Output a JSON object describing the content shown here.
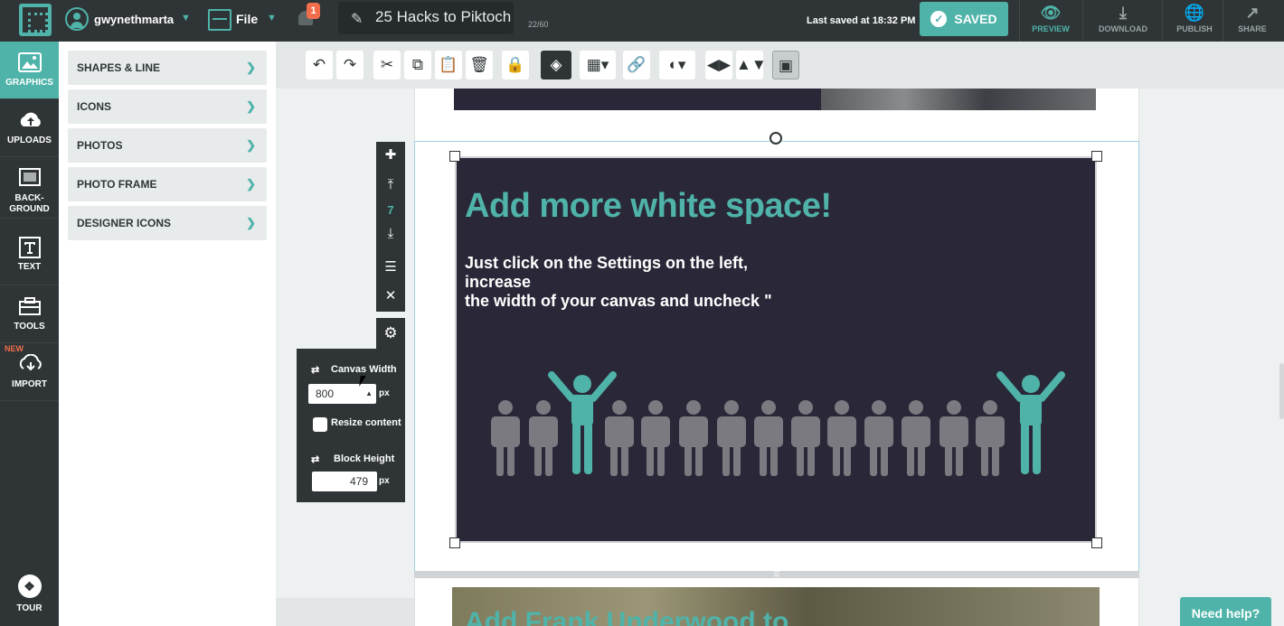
{
  "topbar": {
    "username": "gwynethmarta",
    "file_label": "File",
    "notification_count": "1",
    "doc_title": "25 Hacks to Piktoch",
    "char_count": "22/60",
    "last_saved": "Last saved at 18:32 PM",
    "saved_label": "SAVED",
    "actions": [
      {
        "label": "PREVIEW",
        "icon": "eye-icon"
      },
      {
        "label": "DOWNLOAD",
        "icon": "download-icon"
      },
      {
        "label": "PUBLISH",
        "icon": "globe-icon"
      },
      {
        "label": "SHARE",
        "icon": "share-icon"
      }
    ]
  },
  "sidebar": {
    "items": [
      {
        "label": "GRAPHICS",
        "icon": "image-icon"
      },
      {
        "label": "UPLOADS",
        "icon": "upload-cloud-icon"
      },
      {
        "label": "BACK-",
        "label2": "GROUND",
        "icon": "background-icon"
      },
      {
        "label": "TEXT",
        "icon": "text-icon"
      },
      {
        "label": "TOOLS",
        "icon": "tools-icon"
      },
      {
        "label": "IMPORT",
        "icon": "import-cloud-icon",
        "tag": "NEW"
      }
    ],
    "tour_label": "TOUR"
  },
  "panel": {
    "items": [
      {
        "label": "SHAPES & LINE"
      },
      {
        "label": "ICONS"
      },
      {
        "label": "PHOTOS"
      },
      {
        "label": "PHOTO FRAME"
      },
      {
        "label": "DESIGNER ICONS"
      }
    ]
  },
  "toolbar": {
    "tools": [
      "undo-icon",
      "redo-icon",
      "cut-icon",
      "copy-icon",
      "paste-icon",
      "delete-icon",
      "lock-icon",
      "fill-icon",
      "transparency-icon",
      "link-icon",
      "shape-icon",
      "flip-horizontal-icon",
      "flip-vertical-icon",
      "arrange-icon"
    ]
  },
  "canvas": {
    "headline": "Add more white space!",
    "body_line1": "Just click on the Settings on the left, increase",
    "body_line2": "the width of your canvas and uncheck \"",
    "next_block_text": "Add Frank Underwood to",
    "colors": {
      "accent": "#4fb3a9",
      "block_bg": "#2a2838",
      "person_grey": "#7a7a80"
    }
  },
  "block_controls": {
    "block_number": "7"
  },
  "settings": {
    "canvas_width_label": "Canvas Width",
    "canvas_width_value": "800",
    "unit": "px",
    "resize_label": "Resize content",
    "block_height_label": "Block Height",
    "block_height_value": "479"
  },
  "help_label": "Need help?"
}
